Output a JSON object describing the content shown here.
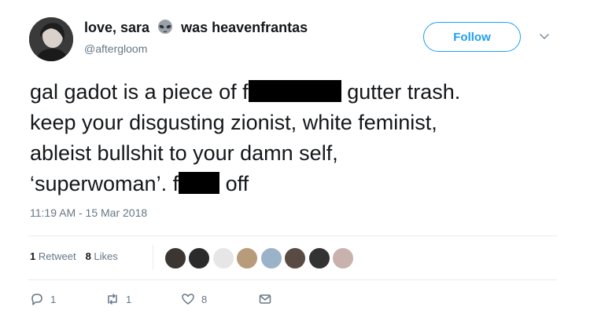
{
  "user": {
    "display_name_part1": "love, sara",
    "display_name_part2": "was heavenfrantas",
    "emoji_icon": "alien-emoji",
    "handle": "@aftergloom"
  },
  "follow_button": {
    "label": "Follow"
  },
  "tweet": {
    "line1_before": "gal gadot is a piece of f",
    "line1_after": "gutter trash.",
    "line2": "keep your disgusting zionist, white feminist,",
    "line3": "ableist bullshit to your damn self,",
    "line4_before": "‘superwoman’. f",
    "line4_after": "off",
    "timestamp": "11:19 AM - 15 Mar 2018"
  },
  "stats": {
    "retweets_count": "1",
    "retweets_label": "Retweet",
    "likes_count": "8",
    "likes_label": "Likes"
  },
  "actions": {
    "reply_count": "1",
    "retweet_count": "1",
    "like_count": "8"
  },
  "colors": {
    "accent": "#1da1f2",
    "text": "#14171a",
    "muted": "#657786",
    "divider": "#e6ecf0"
  }
}
